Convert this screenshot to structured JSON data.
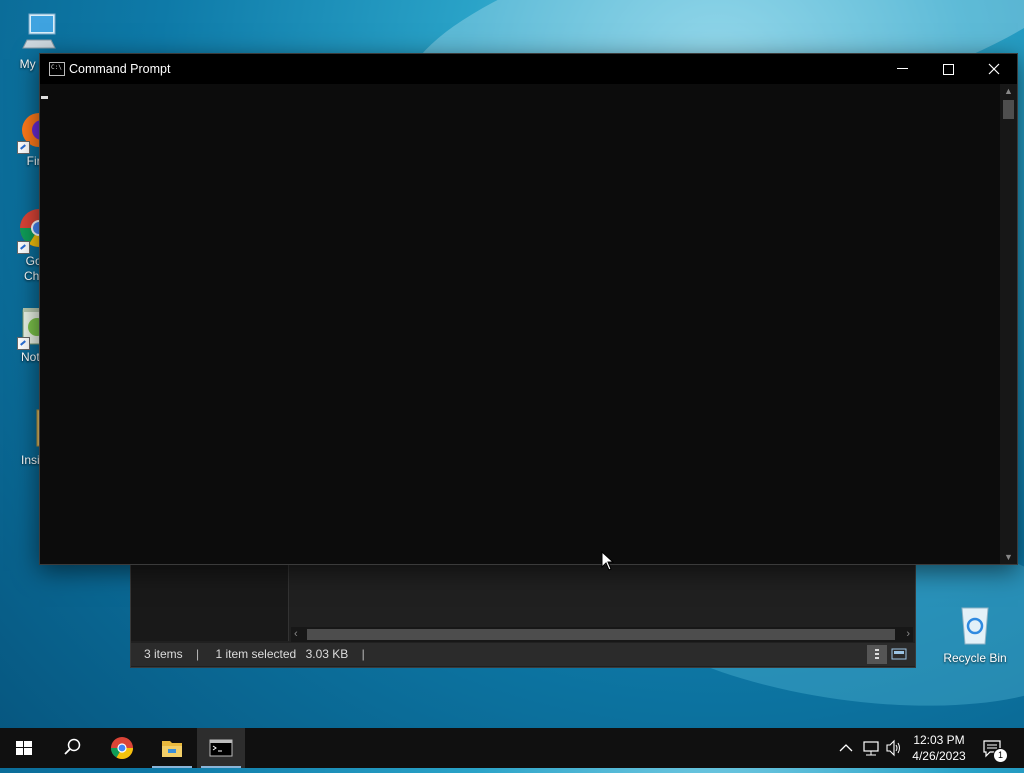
{
  "desktop": {
    "icons": [
      {
        "label": "My Co",
        "icon": "computer-icon"
      },
      {
        "label": "Fire",
        "icon": "firefox-icon"
      },
      {
        "label_line1": "Goo",
        "label_line2": "Chro",
        "icon": "chrome-icon"
      },
      {
        "label": "Notep",
        "icon": "notepad-icon"
      },
      {
        "label": "Inside",
        "icon": "folder-icon"
      }
    ],
    "recycle_bin": {
      "label": "Recycle Bin",
      "icon": "recycle-bin-icon"
    }
  },
  "cmd_window": {
    "title": "Command Prompt",
    "icon": "cmd-icon",
    "controls": {
      "minimize": "minimize-icon",
      "maximize": "maximize-icon",
      "close": "close-icon"
    }
  },
  "explorer_window": {
    "status": {
      "items": "3 items",
      "separator": "|",
      "selected": "1 item selected",
      "size": "3.03 KB"
    }
  },
  "taskbar": {
    "items": [
      {
        "name": "start",
        "icon": "windows-start-icon"
      },
      {
        "name": "search",
        "icon": "search-icon"
      },
      {
        "name": "chrome",
        "icon": "chrome-icon"
      },
      {
        "name": "file-explorer",
        "icon": "folder-icon"
      },
      {
        "name": "command-prompt",
        "icon": "cmd-icon",
        "active": true
      }
    ],
    "tray": {
      "icons": [
        "chevron-up-icon",
        "network-icon",
        "volume-icon"
      ],
      "time": "12:03 PM",
      "date": "4/26/2023",
      "notification_count": "1"
    }
  },
  "colors": {
    "taskbar": "#101010",
    "console_bg": "#0c0c0c",
    "titlebar": "#000000",
    "accent": "#8ab4d8"
  }
}
